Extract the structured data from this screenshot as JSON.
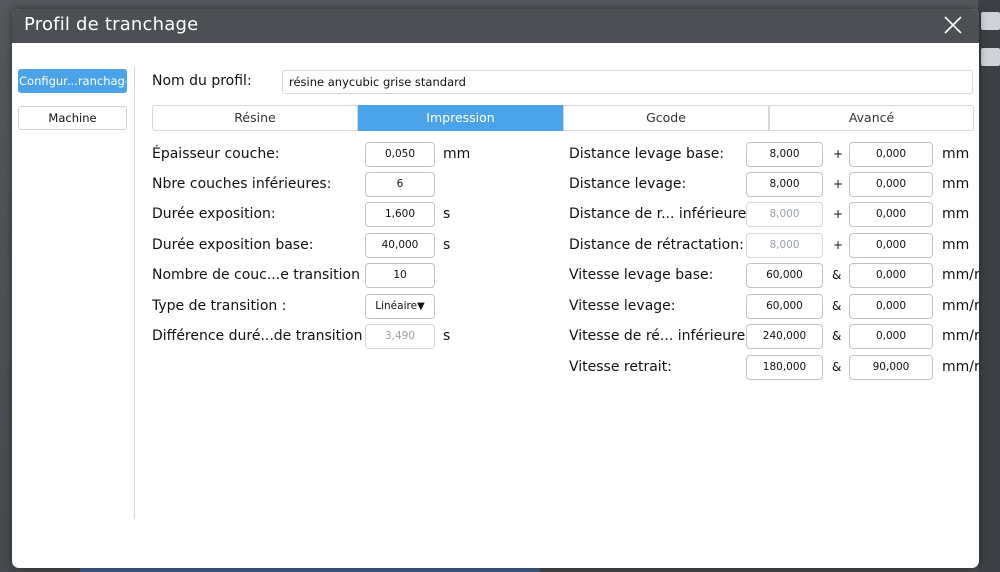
{
  "dialog": {
    "title": "Profil de tranchage"
  },
  "sidebar": {
    "items": [
      {
        "label": "Configur...ranchage"
      },
      {
        "label": "Machine"
      }
    ]
  },
  "profile": {
    "label": "Nom du profil:",
    "value": "résine anycubic grise standard"
  },
  "tabs": [
    {
      "label": "Résine"
    },
    {
      "label": "Impression"
    },
    {
      "label": "Gcode"
    },
    {
      "label": "Avancé"
    }
  ],
  "left_fields": [
    {
      "label": "Épaisseur couche:",
      "value": "0,050",
      "unit": "mm"
    },
    {
      "label": "Nbre couches inférieures:",
      "value": "6",
      "unit": ""
    },
    {
      "label": "Durée exposition:",
      "value": "1,600",
      "unit": "s"
    },
    {
      "label": "Durée exposition base:",
      "value": "40,000",
      "unit": "s"
    },
    {
      "label": "Nombre de couc...e transition :",
      "value": "10",
      "unit": ""
    },
    {
      "label": "Type de transition :",
      "value": "Linéaire",
      "caret": "▼",
      "unit": ""
    },
    {
      "label": "Différence duré...de transition :",
      "value": "3,490",
      "unit": "s"
    }
  ],
  "right_fields": [
    {
      "label": "Distance levage base:",
      "value1": "8,000",
      "sym": "+",
      "value2": "0,000",
      "unit": "mm"
    },
    {
      "label": "Distance levage:",
      "value1": "8,000",
      "sym": "+",
      "value2": "0,000",
      "unit": "mm"
    },
    {
      "label": "Distance de r... inférieure :",
      "value1": "8,000",
      "sym": "+",
      "value2": "0,000",
      "unit": "mm"
    },
    {
      "label": "Distance de rétractation:",
      "value1": "8,000",
      "sym": "+",
      "value2": "0,000",
      "unit": "mm"
    },
    {
      "label": "Vitesse levage base:",
      "value1": "60,000",
      "sym": "&",
      "value2": "0,000",
      "unit": "mm/r"
    },
    {
      "label": "Vitesse levage:",
      "value1": "60,000",
      "sym": "&",
      "value2": "0,000",
      "unit": "mm/r"
    },
    {
      "label": "Vitesse de ré... inférieure :",
      "value1": "240,000",
      "sym": "&",
      "value2": "0,000",
      "unit": "mm/r"
    },
    {
      "label": "Vitesse retrait:",
      "value1": "180,000",
      "sym": "&",
      "value2": "90,000",
      "unit": "mm/r"
    }
  ],
  "colors": {
    "accent": "#4aa3e8",
    "titlebar": "#4c4f54"
  },
  "icons": {
    "close": "close-icon",
    "dropdown": "caret-down-icon"
  }
}
